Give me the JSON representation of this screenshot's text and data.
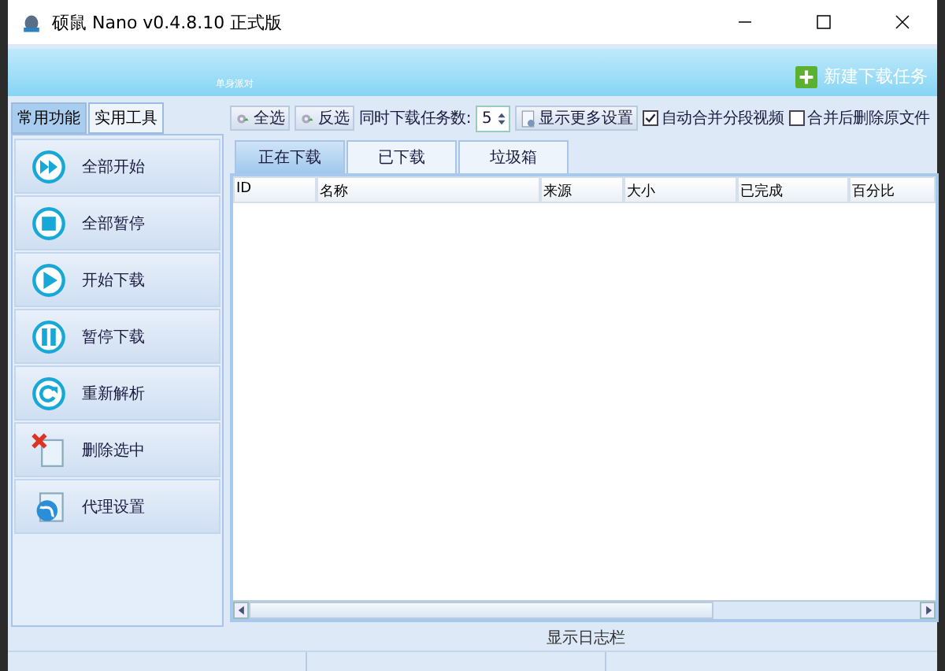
{
  "window": {
    "title": "硕鼠 Nano v0.4.8.10 正式版"
  },
  "banner": {
    "caption": "单身派对",
    "new_task_button": "新建下载任务"
  },
  "side_tabs": [
    {
      "label": "常用功能",
      "selected": true
    },
    {
      "label": "实用工具",
      "selected": false
    }
  ],
  "actions": [
    {
      "label": "全部开始",
      "kind": "startall"
    },
    {
      "label": "全部暂停",
      "kind": "stop"
    },
    {
      "label": "开始下载",
      "kind": "play"
    },
    {
      "label": "暂停下载",
      "kind": "pause"
    },
    {
      "label": "重新解析",
      "kind": "refresh"
    },
    {
      "label": "删除选中",
      "kind": "delete"
    },
    {
      "label": "代理设置",
      "kind": "proxy"
    }
  ],
  "toolbar": {
    "select_all": "全选",
    "invert": "反选",
    "concurrent_label": "同时下载任务数:",
    "concurrent_value": "5",
    "more_settings": "显示更多设置",
    "options": [
      {
        "label": "自动合并分段视频",
        "checked": true
      },
      {
        "label": "合并后删除原文件",
        "checked": false
      }
    ]
  },
  "list_tabs": [
    {
      "label": "正在下载",
      "selected": true
    },
    {
      "label": "已下载",
      "selected": false
    },
    {
      "label": "垃圾箱",
      "selected": false
    }
  ],
  "table": {
    "columns": [
      "ID",
      "名称",
      "来源",
      "大小",
      "已完成",
      "百分比"
    ]
  },
  "log_toggle": "显示日志栏"
}
